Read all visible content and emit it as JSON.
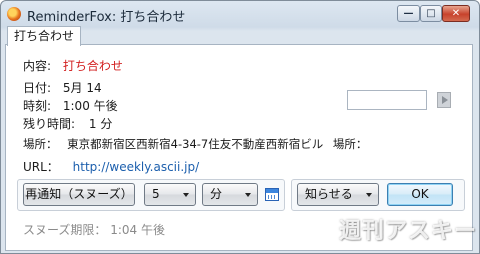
{
  "window": {
    "title": "ReminderFox: 打ち合わせ",
    "minimize_glyph": "—",
    "maximize_glyph": "□",
    "close_glyph": "✕"
  },
  "tab": {
    "label": "打ち合わせ"
  },
  "details": {
    "content_label": "内容:",
    "content_value": "打ち合わせ",
    "date_label": "日付:",
    "date_value": "5月 14",
    "time_label": "時刻:",
    "time_value": "1:00 午後",
    "remaining_label": "残り時間:",
    "remaining_value": "1 分",
    "location_label": "場所：",
    "location_value": "東京都新宿区西新宿4-34-7住友不動産西新宿ビル",
    "location_label2": "場所：",
    "location_input_value": "",
    "url_label": "URL：",
    "url_value": "http://weekly.ascii.jp/"
  },
  "controls": {
    "snooze_button": "再通知（スヌーズ）",
    "snooze_amount": "5",
    "snooze_unit": "分",
    "notify_select": "知らせる",
    "ok_button": "OK",
    "snooze_until": "スヌーズ期限： 1:04 午後"
  },
  "watermark": "週刊アスキー",
  "colors": {
    "content_value": "#d21f1f",
    "url": "#1c5fad"
  }
}
